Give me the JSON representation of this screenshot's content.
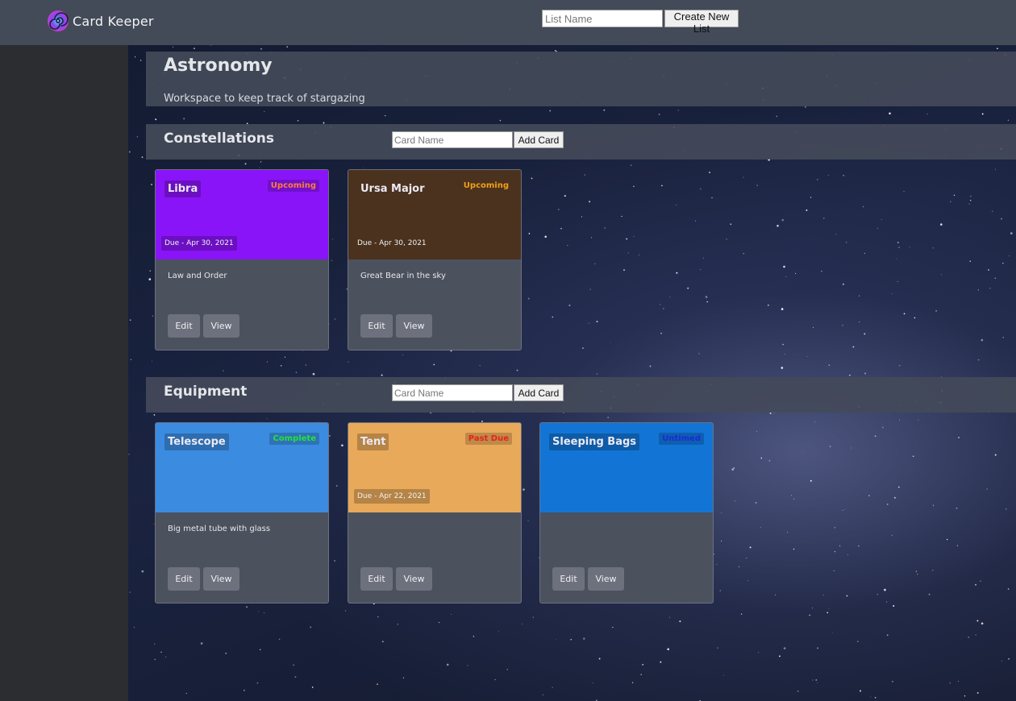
{
  "header": {
    "brand": "Card Keeper",
    "list_name_placeholder": "List Name",
    "create_list_label": "Create New List"
  },
  "workspace": {
    "title": "Astronomy",
    "description": "Workspace to keep track of stargazing"
  },
  "lists": [
    {
      "title": "Constellations",
      "card_name_placeholder": "Card Name",
      "add_card_label": "Add Card",
      "cards": [
        {
          "title": "Libra",
          "status": "Upcoming",
          "due": "Due - Apr 30, 2021",
          "description": "Law and Order",
          "edit_label": "Edit",
          "view_label": "View",
          "color": "#8a14f8",
          "status_color": "#ff7d3b"
        },
        {
          "title": "Ursa Major",
          "status": "Upcoming",
          "due": "Due - Apr 30, 2021",
          "description": "Great Bear in the sky",
          "edit_label": "Edit",
          "view_label": "View",
          "color": "#4a321e",
          "status_color": "#f2a017"
        }
      ]
    },
    {
      "title": "Equipment",
      "card_name_placeholder": "Card Name",
      "add_card_label": "Add Card",
      "cards": [
        {
          "title": "Telescope",
          "status": "Complete",
          "due": "",
          "description": "Big metal tube with glass",
          "edit_label": "Edit",
          "view_label": "View",
          "color": "#3b8ce0",
          "status_color": "#22e23c"
        },
        {
          "title": "Tent",
          "status": "Past Due",
          "due": "Due - Apr 22, 2021",
          "description": "",
          "edit_label": "Edit",
          "view_label": "View",
          "color": "#e8a95a",
          "status_color": "#e8221a"
        },
        {
          "title": "Sleeping Bags",
          "status": "Untimed",
          "due": "",
          "description": "",
          "edit_label": "Edit",
          "view_label": "View",
          "color": "#1275d6",
          "status_color": "#1b2ad8"
        }
      ]
    }
  ]
}
